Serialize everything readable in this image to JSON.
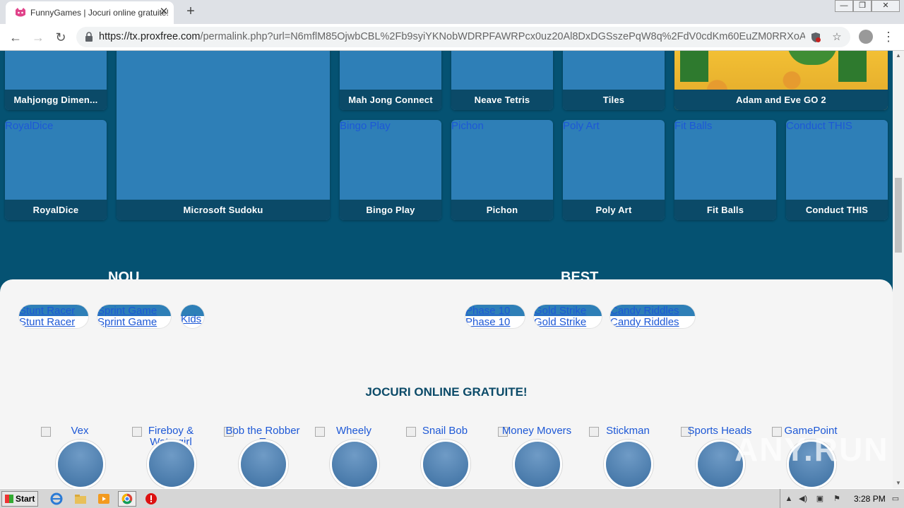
{
  "browser": {
    "tab_title": "FunnyGames | Jocuri online gratuite!",
    "tab_close": "✕",
    "new_tab": "+",
    "window_controls": [
      "—",
      "❐",
      "✕"
    ],
    "url_host": "https://tx.proxfree.com",
    "url_rest": "/permalink.php?url=N6mflM85OjwbCBL%2Fb9syiYKNobWDRPFAWRPcx0uz20Al8DxDGSszePqW8q%2FdV0cdKm60EuZM0RRXoA7Igiu...",
    "back_icon": "←",
    "forward_icon": "→",
    "reload_icon": "↻",
    "star_icon": "☆",
    "menu_icon": "⋮"
  },
  "top_row": [
    {
      "label": "Mahjongg Dimen..."
    },
    {
      "label": "Mah Jong Connect"
    },
    {
      "label": "Neave Tetris"
    },
    {
      "label": "Tiles"
    },
    {
      "label": "Adam and Eve GO 2"
    }
  ],
  "second_row": [
    {
      "alt": "RoyalDice",
      "label": "RoyalDice"
    },
    {
      "alt": "",
      "label": "Microsoft Sudoku"
    },
    {
      "alt": "Bingo Play",
      "label": "Bingo Play"
    },
    {
      "alt": "Pichon",
      "label": "Pichon"
    },
    {
      "alt": "Poly Art",
      "label": "Poly Art"
    },
    {
      "alt": "Fit Balls",
      "label": "Fit Balls"
    },
    {
      "alt": "Conduct THIS",
      "label": "Conduct THIS"
    }
  ],
  "sections": {
    "nou": "NOU",
    "best": "BEST"
  },
  "nou_items": [
    {
      "alt": "Stunt Racer",
      "label": "Stunt Racer"
    },
    {
      "alt": "Sprint Game",
      "label": "Sprint Game"
    },
    {
      "alt": "Kids",
      "label": ""
    }
  ],
  "best_items": [
    {
      "alt": "Phase 10",
      "label": "Phase 10"
    },
    {
      "alt": "Gold Strike",
      "label": "Gold Strike"
    },
    {
      "alt": "Candy Riddles",
      "label": "Candy Riddles"
    }
  ],
  "jocuri_title": "JOCURI ONLINE GRATUITE!",
  "games": [
    {
      "alt": "Vex"
    },
    {
      "alt": "Fireboy & Watergirl"
    },
    {
      "alt": "Bob the Robber T"
    },
    {
      "alt": "Wheely"
    },
    {
      "alt": "Snail Bob"
    },
    {
      "alt": "Money Movers"
    },
    {
      "alt": "Stickman"
    },
    {
      "alt": "Sports Heads"
    },
    {
      "alt": "GamePoint"
    }
  ],
  "watermark": "ANY.RUN",
  "taskbar": {
    "start_label": "Start",
    "clock": "3:28 PM"
  }
}
